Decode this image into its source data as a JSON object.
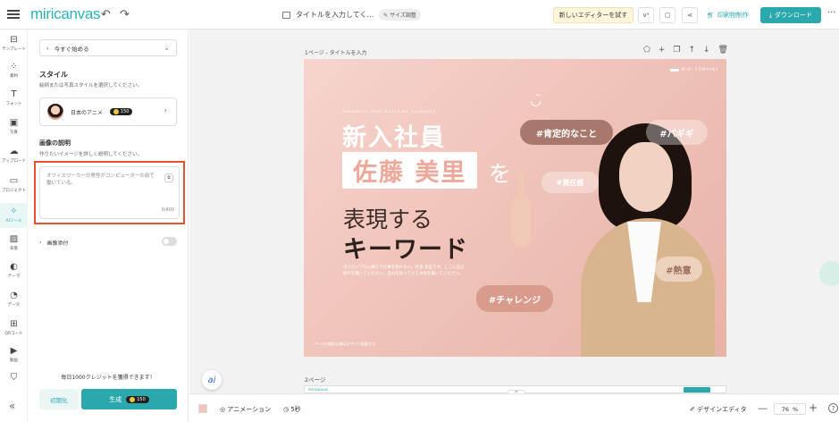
{
  "header": {
    "logo": "miricanvas",
    "doc_title": "タイトルを入力してく...",
    "size_badge": "サイズ調整",
    "try_editor": "新しいエディターを試す",
    "print_label": "印刷物制作",
    "download_label": "ダウンロード",
    "undo_icon": "undo-icon",
    "redo_icon": "redo-icon",
    "more": "···"
  },
  "rail": {
    "items": [
      {
        "label": "テンプレート",
        "icon": "template-icon"
      },
      {
        "label": "素材",
        "icon": "elements-icon"
      },
      {
        "label": "フォント",
        "icon": "font-icon"
      },
      {
        "label": "写真",
        "icon": "photo-icon"
      },
      {
        "label": "アップロード",
        "icon": "upload-icon"
      },
      {
        "label": "プロジェクト",
        "icon": "project-icon"
      },
      {
        "label": "AIツール",
        "icon": "ai-tools-icon"
      },
      {
        "label": "背景",
        "icon": "background-icon"
      },
      {
        "label": "テーマ",
        "icon": "theme-icon"
      },
      {
        "label": "データ",
        "icon": "data-icon"
      },
      {
        "label": "QRコード",
        "icon": "qr-icon"
      },
      {
        "label": "動画",
        "icon": "video-icon"
      },
      {
        "label": "",
        "icon": "bookmark-icon"
      }
    ],
    "collapse": "«"
  },
  "panel": {
    "start_select": "今すぐ始める",
    "style_heading": "スタイル",
    "style_sub": "絵柄または写真スタイルを選択してください。",
    "style_name": "日本のアニメ",
    "style_cost": "150",
    "desc_heading": "画像の説明",
    "desc_sub": "作りたいイメージを詳しく説明してください。",
    "desc_value": "オフィスワーカーの男性がコンピューターの前で働いている。",
    "desc_counter": "0/400",
    "attach_label": "画像添付",
    "credit_text": "毎日1000クレジットを獲得できます！",
    "reset_label": "初期化",
    "generate_label": "生成",
    "generate_cost": "150"
  },
  "canvas": {
    "page1_label": "1ページ - タイトルを入力",
    "page2_label": "2ページ",
    "page2_mini_logo": "miricanvas",
    "scroll_up": "^",
    "slide": {
      "company": "MIRI COMPANY",
      "tagline": "ASSEMBLE THAT DESCRIBE YOURSELF",
      "line1": "新入社員",
      "name": "佐藤 美里",
      "wo": "を",
      "line3": "表現する",
      "line4": "キーワード",
      "body": "ポジティブな心構えで仕事を恐れない。社長 美里です。ここに自己紹介を書いてください。自分を知ってさえ文章を書いてください。",
      "footer": "ページの幅は点線はデザイン画面です。",
      "tags": [
        "#肯定的なこと",
        "#パギギ",
        "#責任感",
        "#熱意",
        "#チャレンジ"
      ]
    }
  },
  "bottombar": {
    "animation": "アニメーション",
    "duration": "5秒",
    "design_editor": "デザインエディタ",
    "zoom": "76",
    "zoom_unit": "%",
    "minus": "—",
    "plus": "+",
    "help": "?"
  },
  "ai_fab": "ai"
}
